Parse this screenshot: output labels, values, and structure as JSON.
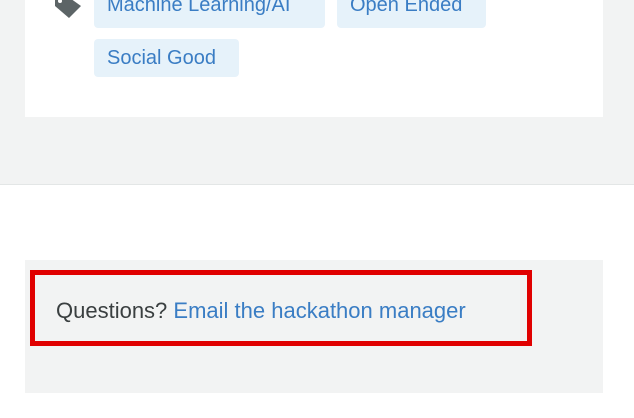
{
  "tags": {
    "icon": "tag-icon",
    "items": [
      "Machine Learning/AI",
      "Open Ended",
      "Social Good"
    ]
  },
  "questions": {
    "prefix": "Questions?",
    "link_text": "Email the hackathon manager"
  },
  "colors": {
    "link": "#3a7dc4",
    "tag_background": "#e6f2fa",
    "highlight_border": "#e00000",
    "band_background": "#f2f3f3"
  }
}
